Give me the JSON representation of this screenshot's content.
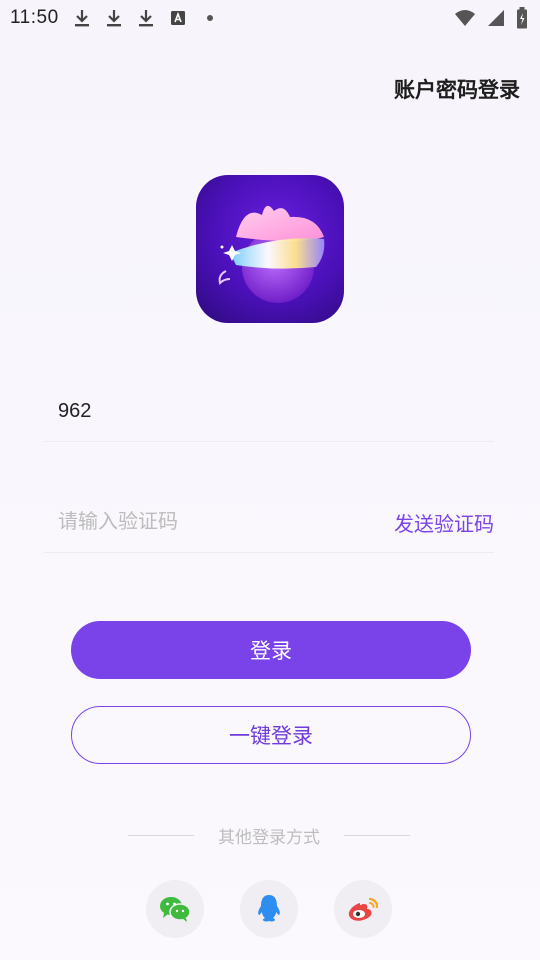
{
  "status_bar": {
    "time": "11:50",
    "left_icons": [
      "download-icon",
      "download-icon",
      "download-icon",
      "a-box-icon",
      "dot-icon"
    ],
    "right_icons": [
      "wifi-icon",
      "signal-icon",
      "battery-charging-icon"
    ]
  },
  "header": {
    "account_login": "账户密码登录"
  },
  "logo": {
    "icon": "app-logo-icon"
  },
  "form": {
    "phone_value": "962",
    "code_placeholder": "请输入验证码",
    "send_code": "发送验证码"
  },
  "buttons": {
    "login": "登录",
    "one_key_login": "一键登录"
  },
  "other_login": {
    "label": "其他登录方式",
    "options": [
      "wechat-icon",
      "qq-icon",
      "weibo-icon"
    ]
  },
  "colors": {
    "accent": "#7a43ea",
    "wechat": "#3fba3f",
    "qq": "#2e8ef0",
    "weibo": "#e84545"
  }
}
